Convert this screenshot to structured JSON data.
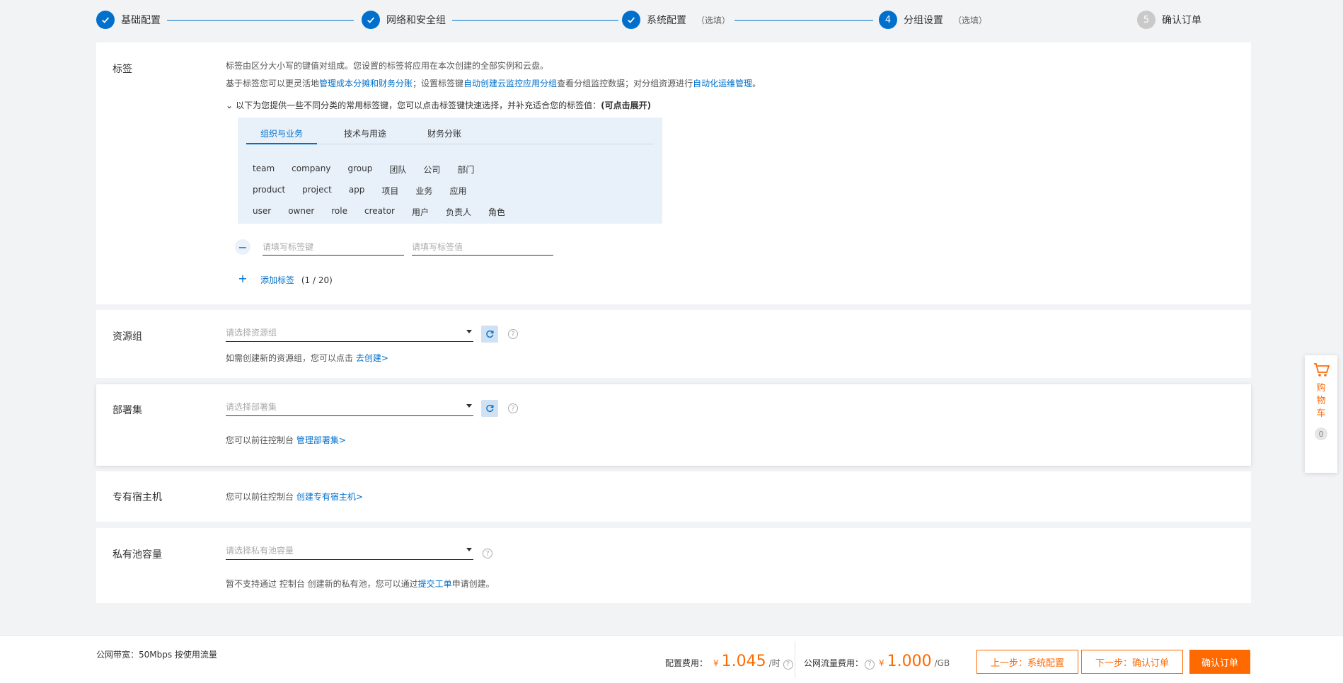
{
  "steps": [
    {
      "label": "基础配置",
      "optional": ""
    },
    {
      "label": "网络和安全组",
      "optional": ""
    },
    {
      "label": "系统配置",
      "optional": "（选填）"
    },
    {
      "label": "分组设置",
      "optional": "（选填）",
      "number": "4"
    },
    {
      "label": "确认订单",
      "optional": "",
      "number": "5"
    }
  ],
  "tags": {
    "title": "标签",
    "desc1": "标签由区分大小写的键值对组成。您设置的标签将应用在本次创建的全部实例和云盘。",
    "desc2_a": "基于标签您可以更灵活地",
    "desc2_link1": "管理成本分摊和财务分账",
    "desc2_b": "；设置标签键",
    "desc2_link2": "自动创建云监控应用分组",
    "desc2_c": "查看分组监控数据；对分组资源进行",
    "desc2_link3": "自动化运维管理",
    "desc2_d": "。",
    "expand_text": "以下为您提供一些不同分类的常用标签键，您可以点击标签键快速选择，并补充适合您的标签值：",
    "expand_bold": "(可点击展开)",
    "tabs": [
      "组织与业务",
      "技术与用途",
      "财务分账"
    ],
    "rows": [
      [
        "team",
        "company",
        "group",
        "团队",
        "公司",
        "部门"
      ],
      [
        "product",
        "project",
        "app",
        "项目",
        "业务",
        "应用"
      ],
      [
        "user",
        "owner",
        "role",
        "creator",
        "用户",
        "负责人",
        "角色"
      ]
    ],
    "key_placeholder": "请填写标签键",
    "value_placeholder": "请填写标签值",
    "add_label": "添加标签",
    "add_count": "(1 / 20)"
  },
  "resource_group": {
    "title": "资源组",
    "placeholder": "请选择资源组",
    "hint": "如需创建新的资源组，您可以点击",
    "hint_link": "去创建>"
  },
  "deploy_set": {
    "title": "部署集",
    "placeholder": "请选择部署集",
    "hint": "您可以前往控制台",
    "hint_link": "管理部署集>"
  },
  "dedicated_host": {
    "title": "专有宿主机",
    "hint": "您可以前往控制台",
    "hint_link": "创建专有宿主机>"
  },
  "private_pool": {
    "title": "私有池容量",
    "placeholder": "请选择私有池容量",
    "hint_a": "暂不支持通过 控制台 创建新的私有池，您可以通过",
    "hint_link": "提交工单",
    "hint_b": "申请创建。"
  },
  "cart": {
    "label": "购物车",
    "count": "0"
  },
  "footer": {
    "bandwidth": "公网带宽：50Mbps 按使用流量",
    "config_fee_label": "配置费用：",
    "currency": "¥",
    "config_fee": "1.045",
    "config_unit": "/时",
    "traffic_fee_label": "公网流量费用：",
    "traffic_fee": "1.000",
    "traffic_unit": "/GB",
    "prev_label": "上一步：系统配置",
    "next_label": "下一步：确认订单",
    "confirm_label": "确认订单"
  },
  "colors": {
    "primary": "#0070cc",
    "accent": "#ff6a00"
  }
}
